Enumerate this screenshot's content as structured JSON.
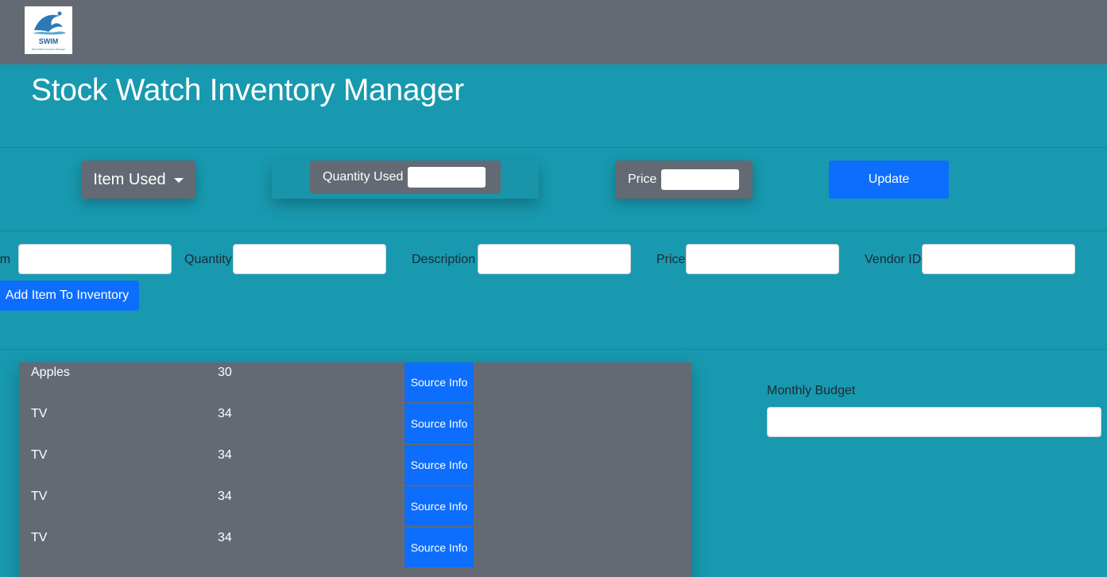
{
  "header": {
    "logo_text": "SWIM",
    "logo_subtext": "Stock Watch Inventory Manager",
    "title": "Stock Watch Inventory Manager"
  },
  "update_bar": {
    "item_used_label": "Item Used",
    "quantity_used_label": "Quantity Used",
    "quantity_used_value": "",
    "price_label": "Price",
    "price_value": "",
    "update_label": "Update"
  },
  "add_form": {
    "item_label": "Item",
    "quantity_label": "Quantity",
    "description_label": "Description",
    "price_label": "Price",
    "vendor_label": "Vendor ID",
    "add_button_label": "Add Item To Inventory"
  },
  "inventory": {
    "source_button_label": "Source Info",
    "rows": [
      {
        "name": "Apples",
        "qty": "30"
      },
      {
        "name": "TV",
        "qty": "34"
      },
      {
        "name": "TV",
        "qty": "34"
      },
      {
        "name": "TV",
        "qty": "34"
      },
      {
        "name": "TV",
        "qty": "34"
      }
    ]
  },
  "budget": {
    "label": "Monthly Budget",
    "value": ""
  },
  "colors": {
    "background": "#1899af",
    "topbar": "#636a73",
    "primary": "#0d6efd"
  }
}
